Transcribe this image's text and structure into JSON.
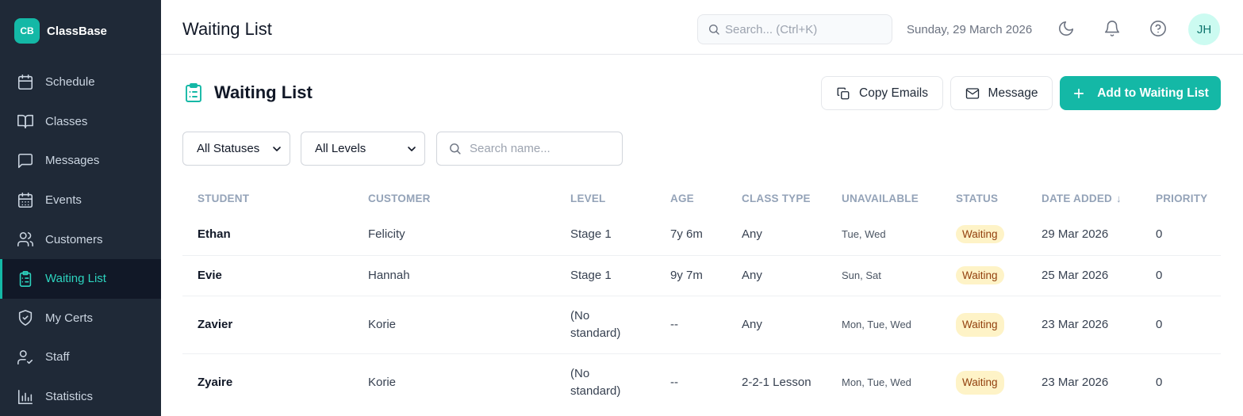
{
  "brand": {
    "logo": "CB",
    "name": "ClassBase"
  },
  "sidebar": {
    "items": [
      {
        "label": "Schedule",
        "icon": "calendar-icon"
      },
      {
        "label": "Classes",
        "icon": "book-open-icon"
      },
      {
        "label": "Messages",
        "icon": "message-square-icon"
      },
      {
        "label": "Events",
        "icon": "calendar-days-icon"
      },
      {
        "label": "Customers",
        "icon": "users-icon"
      },
      {
        "label": "Waiting List",
        "icon": "clipboard-list-icon",
        "active": true
      },
      {
        "label": "My Certs",
        "icon": "shield-check-icon"
      },
      {
        "label": "Staff",
        "icon": "user-check-icon"
      },
      {
        "label": "Statistics",
        "icon": "bar-chart-icon"
      }
    ]
  },
  "header": {
    "title": "Waiting List",
    "search_placeholder": "Search... (Ctrl+K)",
    "date": "Sunday, 29 March 2026",
    "avatar_initials": "JH"
  },
  "main": {
    "title": "Waiting List",
    "buttons": {
      "copy_emails": "Copy Emails",
      "message": "Message",
      "add": "Add to Waiting List"
    },
    "filters": {
      "status": "All Statuses",
      "level": "All Levels",
      "search_placeholder": "Search name..."
    },
    "table": {
      "columns": [
        "STUDENT",
        "CUSTOMER",
        "LEVEL",
        "AGE",
        "CLASS TYPE",
        "UNAVAILABLE",
        "STATUS",
        "DATE ADDED",
        "PRIORITY"
      ],
      "rows": [
        {
          "student": "Ethan",
          "customer": "Felicity",
          "level": "Stage 1",
          "age": "7y 6m",
          "class_type": "Any",
          "unavailable": "Tue, Wed",
          "status": "Waiting",
          "date_added": "29 Mar 2026",
          "priority": "0"
        },
        {
          "student": "Evie",
          "customer": "Hannah",
          "level": "Stage 1",
          "age": "9y 7m",
          "class_type": "Any",
          "unavailable": "Sun, Sat",
          "status": "Waiting",
          "date_added": "25 Mar 2026",
          "priority": "0"
        },
        {
          "student": "Zavier",
          "customer": "Korie",
          "level": "(No standard)",
          "age": "--",
          "class_type": "Any",
          "unavailable": "Mon, Tue, Wed",
          "status": "Waiting",
          "date_added": "23 Mar 2026",
          "priority": "0"
        },
        {
          "student": "Zyaire",
          "customer": "Korie",
          "level": "(No standard)",
          "age": "--",
          "class_type": "2-2-1 Lesson",
          "unavailable": "Mon, Tue, Wed",
          "status": "Waiting",
          "date_added": "23 Mar 2026",
          "priority": "0"
        }
      ]
    }
  },
  "colors": {
    "accent": "#14b8a6",
    "sidebar_bg": "#1f2937",
    "badge_bg": "#fef3c7",
    "badge_text": "#92400e"
  }
}
